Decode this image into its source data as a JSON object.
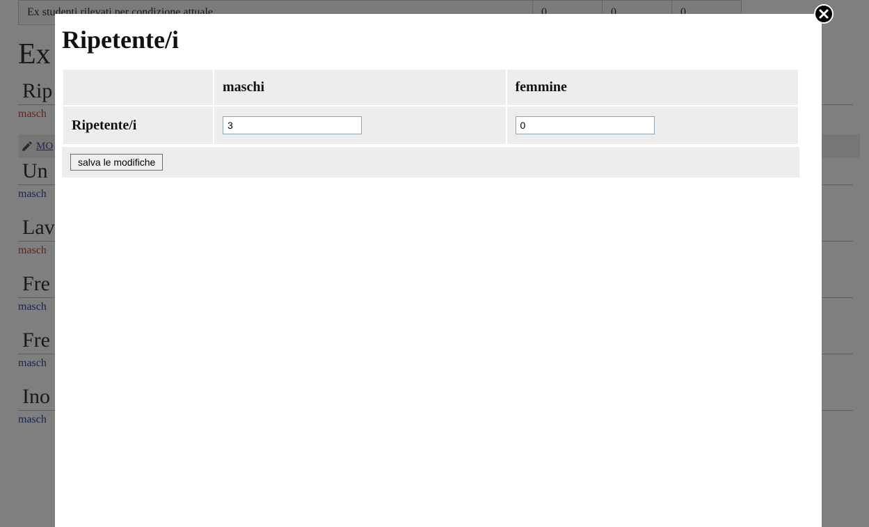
{
  "background": {
    "table_row_label": "Ex studenti rilevati per condizione attuale",
    "table_row_values": [
      "0",
      "0",
      "0"
    ],
    "main_heading": "Ex",
    "modifica_label": " MO",
    "sections": [
      {
        "title": "Rip",
        "sub": "masch",
        "sub_color": "red"
      },
      {
        "title": "Un",
        "sub": "masch",
        "sub_color": "blue"
      },
      {
        "title": "Lav",
        "sub": "masch",
        "sub_color": "red"
      },
      {
        "title": "Fre",
        "sub": "masch",
        "sub_color": "blue"
      },
      {
        "title": "Fre",
        "sub": "masch",
        "sub_color": "blue"
      },
      {
        "title": "Ino",
        "sub": "masch",
        "sub_color": "blue"
      }
    ]
  },
  "modal": {
    "title": "Ripetente/i",
    "col_maschi": "maschi",
    "col_femmine": "femmine",
    "row_label": "Ripetente/i",
    "value_maschi": "3",
    "value_femmine": "0",
    "save_button": "salva le modifiche"
  }
}
